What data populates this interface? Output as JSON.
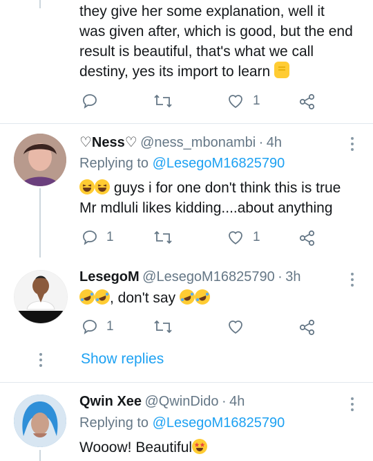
{
  "top_tweet": {
    "text_lines": [
      "they give her some explanation, well it",
      "was given after, which is good, but the end",
      "result is beautiful, that's what we call",
      "destiny, yes its import to learn"
    ],
    "like_count": "1"
  },
  "reply1": {
    "name": "♡Ness♡",
    "handle": "@ness_mbonambi",
    "sep": "·",
    "time": "4h",
    "replying_label": "Replying to",
    "replying_handle": "@LesegoM16825790",
    "text_line1": "guys i for one don't think this is true",
    "text_line2": "Mr mdluli likes kidding....about anything",
    "reply_count": "1",
    "like_count": "1"
  },
  "reply2": {
    "name": "LesegoM",
    "handle": "@LesegoM16825790",
    "sep": "·",
    "time": "3h",
    "text_mid": ", don't say",
    "reply_count": "1",
    "show_replies": "Show replies"
  },
  "reply3": {
    "name": "Qwin Xee",
    "handle": "@QwinDido",
    "sep": "·",
    "time": "4h",
    "replying_label": "Replying to",
    "replying_handle": "@LesegoM16825790",
    "text": "Wooow! Beautiful"
  },
  "colors": {
    "accent": "#1da1f2",
    "muted": "#657786",
    "divider": "#e1e8ed"
  },
  "icons": [
    "reply-icon",
    "retweet-icon",
    "like-icon",
    "share-icon",
    "more-icon",
    "raised-fist-emoji",
    "laughing-emoji",
    "rofl-emoji",
    "star-struck-emoji"
  ]
}
